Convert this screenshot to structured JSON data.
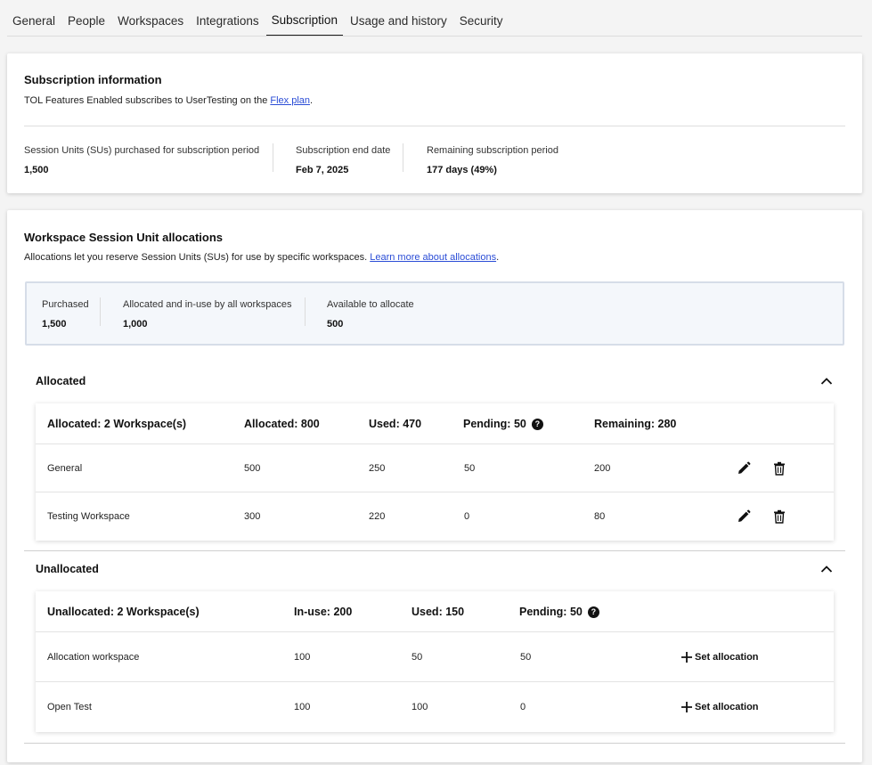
{
  "tabs": [
    "General",
    "People",
    "Workspaces",
    "Integrations",
    "Subscription",
    "Usage and history",
    "Security"
  ],
  "active_tab": "Subscription",
  "subscription": {
    "title": "Subscription information",
    "desc_prefix": "TOL Features Enabled subscribes to UserTesting on the ",
    "plan_link": "Flex plan",
    "desc_suffix": ".",
    "stats": [
      {
        "label": "Session Units (SUs) purchased for subscription period",
        "value": "1,500"
      },
      {
        "label": "Subscription end date",
        "value": "Feb 7, 2025"
      },
      {
        "label": "Remaining subscription period",
        "value": "177 days (49%)"
      }
    ]
  },
  "allocations": {
    "title": "Workspace Session Unit allocations",
    "desc": "Allocations let you reserve Session Units (SUs) for use by specific workspaces. ",
    "learn_link": "Learn more about allocations",
    "desc_suffix": ".",
    "summary": [
      {
        "label": "Purchased",
        "value": "1,500"
      },
      {
        "label": "Allocated and in-use by all workspaces",
        "value": "1,000"
      },
      {
        "label": "Available to allocate",
        "value": "500"
      }
    ]
  },
  "allocated": {
    "section_title": "Allocated",
    "header": {
      "name": "Allocated: 2 Workspace(s)",
      "allocated": "Allocated: 800",
      "used": "Used: 470",
      "pending": "Pending: 50",
      "remaining": "Remaining: 280"
    },
    "rows": [
      {
        "name": "General",
        "allocated": "500",
        "used": "250",
        "pending": "50",
        "remaining": "200"
      },
      {
        "name": "Testing Workspace",
        "allocated": "300",
        "used": "220",
        "pending": "0",
        "remaining": "80"
      }
    ]
  },
  "unallocated": {
    "section_title": "Unallocated",
    "header": {
      "name": "Unallocated: 2 Workspace(s)",
      "inuse": "In-use: 200",
      "used": "Used: 150",
      "pending": "Pending: 50"
    },
    "set_label": "Set allocation",
    "rows": [
      {
        "name": "Allocation workspace",
        "inuse": "100",
        "used": "50",
        "pending": "50"
      },
      {
        "name": "Open Test",
        "inuse": "100",
        "used": "100",
        "pending": "0"
      }
    ]
  },
  "help_icon_glyph": "?"
}
